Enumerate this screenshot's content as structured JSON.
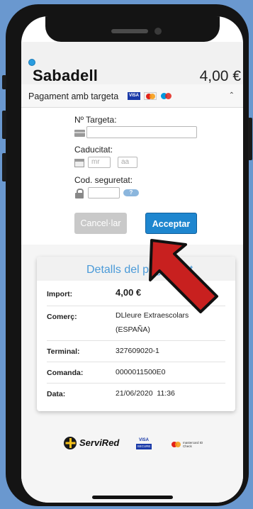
{
  "header": {
    "brand": "Sabadell",
    "amount": "4,00 €"
  },
  "payment_bar": {
    "label": "Pagament amb targeta",
    "card_logos": [
      "visa-logo",
      "mastercard-logo",
      "maestro-logo"
    ],
    "visa_text": "VISA",
    "collapse_icon": "chevron-up-icon"
  },
  "form": {
    "card_number_label": "Nº Targeta:",
    "card_number_value": "",
    "expiry_label": "Caducitat:",
    "expiry_month_placeholder": "mr",
    "expiry_year_placeholder": "aa",
    "cvv_label": "Cod. seguretat:",
    "cvv_value": "",
    "help_text": "?"
  },
  "buttons": {
    "cancel": "Cancel·lar",
    "accept": "Acceptar"
  },
  "details": {
    "title": "Detalls del pagament",
    "rows": [
      {
        "key": "Import:",
        "value": "4,00 €"
      },
      {
        "key": "Comerç:",
        "value": "DLleure Extraescolars",
        "value2": "(ESPAÑA)"
      },
      {
        "key": "Terminal:",
        "value": "327609020-1"
      },
      {
        "key": "Comanda:",
        "value": "0000011500E0"
      },
      {
        "key": "Data:",
        "value": "21/06/2020  11:36"
      }
    ]
  },
  "footer": {
    "servired": "ServiRed",
    "visa_secure_top": "VISA",
    "visa_secure_bottom": "SECURE",
    "mc_idcheck": "mastercard ID Check"
  },
  "colors": {
    "background": "#6a98cf",
    "accent": "#1e86cf",
    "details_title": "#4a9ad8",
    "arrow": "#c8201f"
  }
}
